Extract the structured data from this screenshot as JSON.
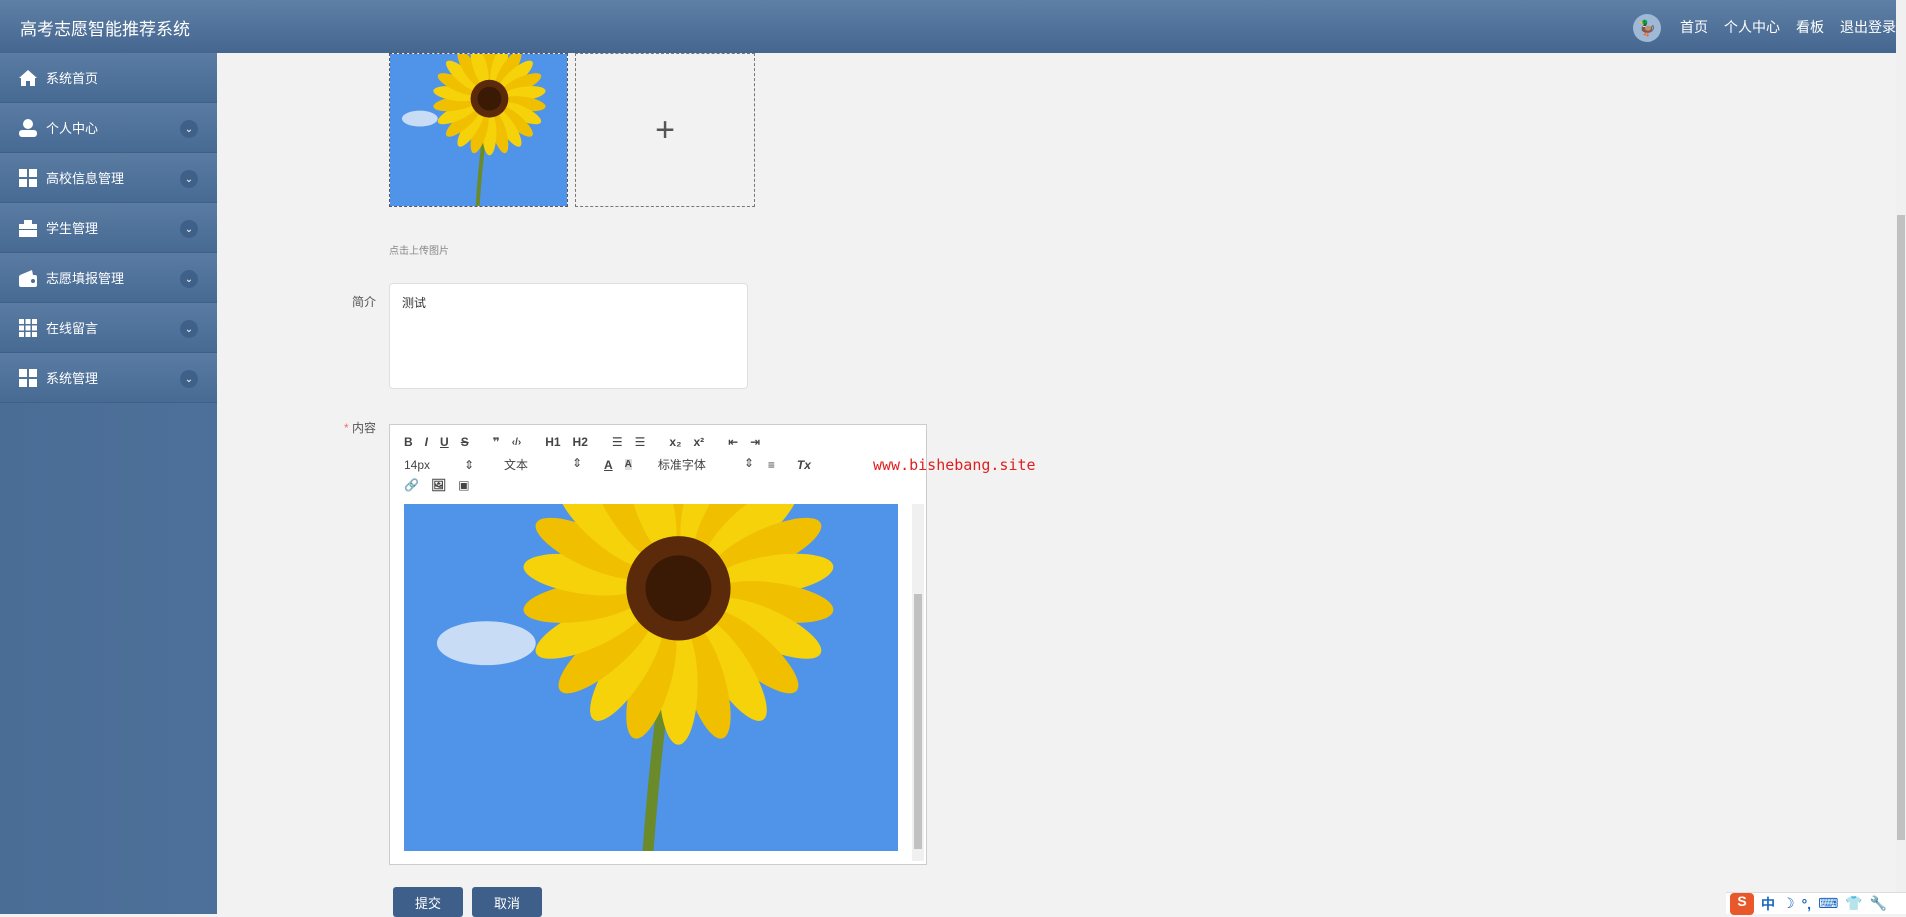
{
  "header": {
    "title": "高考志愿智能推荐系统",
    "nav": [
      "首页",
      "个人中心",
      "看板",
      "退出登录"
    ]
  },
  "sidebar": {
    "items": [
      {
        "label": "系统首页",
        "icon": "home-icon"
      },
      {
        "label": "个人中心",
        "icon": "user-icon"
      },
      {
        "label": "高校信息管理",
        "icon": "grid-icon"
      },
      {
        "label": "学生管理",
        "icon": "briefcase-icon"
      },
      {
        "label": "志愿填报管理",
        "icon": "wallet-icon"
      },
      {
        "label": "在线留言",
        "icon": "grid9-icon"
      },
      {
        "label": "系统管理",
        "icon": "grid-icon"
      }
    ]
  },
  "form": {
    "upload_hint": "点击上传图片",
    "intro_label": "简介",
    "intro_value": "测试",
    "content_label": "内容",
    "required_mark": "*",
    "toolbar": {
      "font_size": "14px",
      "text_type": "文本",
      "font_family": "标准字体",
      "buttons": [
        "B",
        "I",
        "U",
        "S",
        "❞",
        "‹/›",
        "H1",
        "H2",
        "x₂",
        "x²",
        "Tx"
      ]
    },
    "submit": "提交",
    "cancel": "取消"
  },
  "watermark": "www.bishebang.site",
  "ime": {
    "lang": "中"
  }
}
